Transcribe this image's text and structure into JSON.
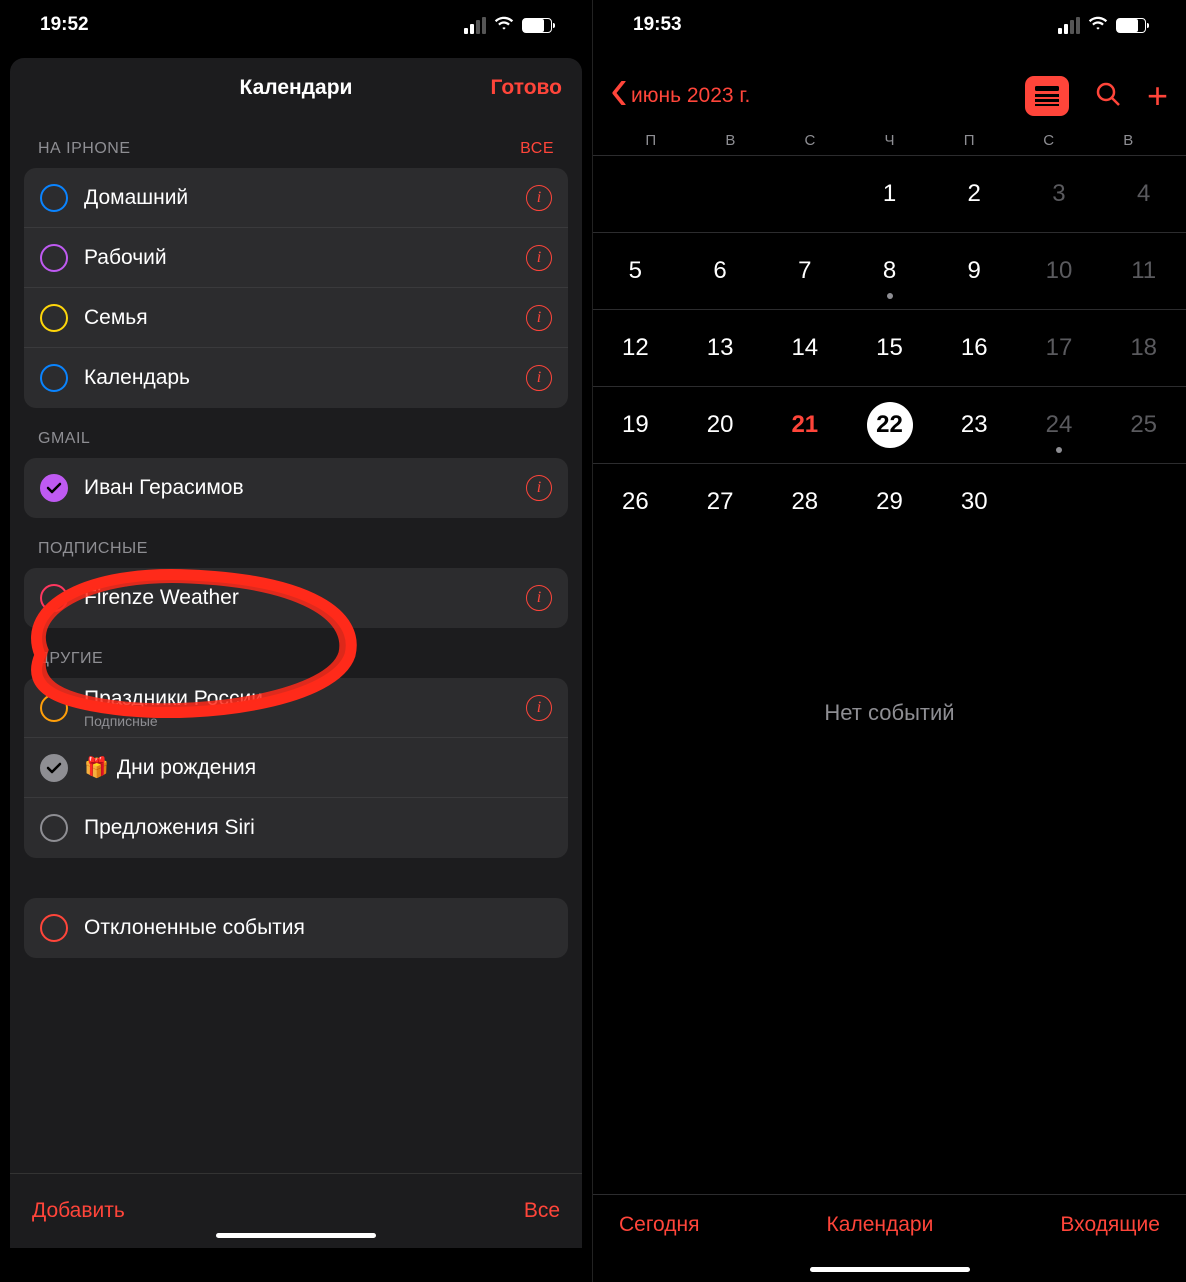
{
  "left": {
    "status": {
      "time": "19:52"
    },
    "header": {
      "title": "Календари",
      "done": "Готово"
    },
    "sections": {
      "iphone": {
        "label": "НА IPHONE",
        "all": "ВСЕ"
      },
      "gmail": {
        "label": "GMAIL"
      },
      "subscribed": {
        "label": "ПОДПИСНЫЕ"
      },
      "other": {
        "label": "ДРУГИЕ"
      }
    },
    "calendars": {
      "iphone": [
        {
          "name": "Домашний",
          "color": "#0a84ff"
        },
        {
          "name": "Рабочий",
          "color": "#bf5af2"
        },
        {
          "name": "Семья",
          "color": "#ffd60a"
        },
        {
          "name": "Календарь",
          "color": "#0a84ff"
        }
      ],
      "gmail": [
        {
          "name": "Иван Герасимов",
          "color": "#bf5af2",
          "checked": true
        }
      ],
      "subscribed": [
        {
          "name": "Firenze Weather",
          "color": "#ff375f"
        }
      ],
      "other": [
        {
          "name": "Праздники России",
          "sub": "Подписные",
          "color": "#ff9f0a"
        },
        {
          "name": "Дни рождения",
          "color": "#8e8e93",
          "checked": true,
          "gift": true
        },
        {
          "name": "Предложения Siri",
          "color": "#8e8e93"
        }
      ],
      "declined": {
        "name": "Отклоненные события",
        "color": "#ff453a"
      }
    },
    "footer": {
      "add": "Добавить",
      "all": "Все"
    }
  },
  "right": {
    "status": {
      "time": "19:53"
    },
    "nav": {
      "month": "июнь 2023 г."
    },
    "weekdays": [
      "П",
      "В",
      "С",
      "Ч",
      "П",
      "С",
      "В"
    ],
    "grid": [
      [
        {
          "n": ""
        },
        {
          "n": ""
        },
        {
          "n": ""
        },
        {
          "n": "1"
        },
        {
          "n": "2"
        },
        {
          "n": "3",
          "w": true
        },
        {
          "n": "4",
          "w": true
        }
      ],
      [
        {
          "n": "5"
        },
        {
          "n": "6"
        },
        {
          "n": "7"
        },
        {
          "n": "8",
          "dot": true
        },
        {
          "n": "9"
        },
        {
          "n": "10",
          "w": true
        },
        {
          "n": "11",
          "w": true
        }
      ],
      [
        {
          "n": "12"
        },
        {
          "n": "13"
        },
        {
          "n": "14"
        },
        {
          "n": "15"
        },
        {
          "n": "16"
        },
        {
          "n": "17",
          "w": true
        },
        {
          "n": "18",
          "w": true
        }
      ],
      [
        {
          "n": "19"
        },
        {
          "n": "20"
        },
        {
          "n": "21",
          "red": true
        },
        {
          "n": "22",
          "sel": true
        },
        {
          "n": "23"
        },
        {
          "n": "24",
          "w": true,
          "dot": true
        },
        {
          "n": "25",
          "w": true
        }
      ],
      [
        {
          "n": "26"
        },
        {
          "n": "27"
        },
        {
          "n": "28"
        },
        {
          "n": "29"
        },
        {
          "n": "30"
        },
        {
          "n": ""
        },
        {
          "n": ""
        }
      ]
    ],
    "no_events": "Нет событий",
    "tabs": {
      "today": "Сегодня",
      "calendars": "Календари",
      "inbox": "Входящие"
    }
  }
}
